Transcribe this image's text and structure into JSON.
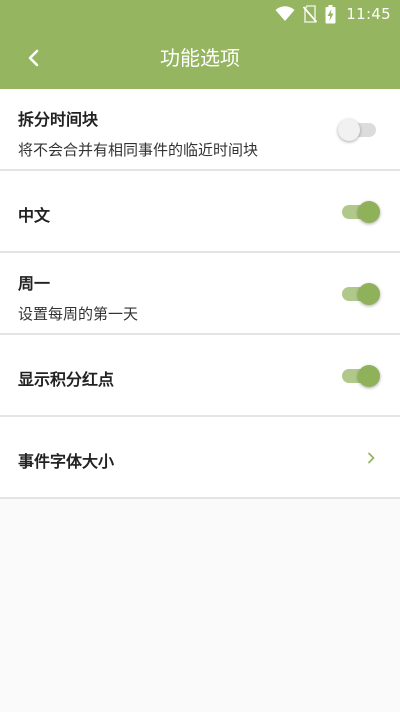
{
  "status_bar": {
    "time": "11:45",
    "icons": [
      "wifi-icon",
      "no-sim-icon",
      "battery-charging-icon"
    ]
  },
  "toolbar": {
    "title": "功能选项",
    "back_icon": "chevron-left-icon"
  },
  "settings": [
    {
      "title": "拆分时间块",
      "subtitle": "将不会合并有相同事件的临近时间块",
      "control": "switch",
      "checked": false
    },
    {
      "title": "中文",
      "control": "switch",
      "checked": true
    },
    {
      "title": "周一",
      "subtitle": "设置每周的第一天",
      "control": "switch",
      "checked": true
    },
    {
      "title": "显示积分红点",
      "control": "switch",
      "checked": true
    },
    {
      "title": "事件字体大小",
      "control": "chevron",
      "icon": "chevron-right-icon"
    }
  ],
  "colors": {
    "accent": "#95b560",
    "switch_on": "#8fb15a",
    "switch_on_track": "#b0c98a",
    "switch_off": "#f1f1f1",
    "background": "#fafafa"
  }
}
